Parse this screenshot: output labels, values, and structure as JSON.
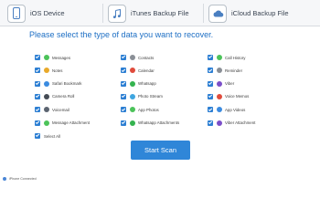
{
  "tabs": [
    {
      "label": "iOS Device",
      "icon": "phone-icon"
    },
    {
      "label": "iTunes Backup File",
      "icon": "music-note-icon"
    },
    {
      "label": "iCloud Backup File",
      "icon": "cloud-icon"
    }
  ],
  "prompt": "Please select the type of data you want to recover.",
  "data_types": {
    "col1": [
      {
        "label": "Messages",
        "color": "#4cc35a"
      },
      {
        "label": "Notes",
        "color": "#e9a92a"
      },
      {
        "label": "Safari Bookmark",
        "color": "#3b8be0"
      },
      {
        "label": "Camera Roll",
        "color": "#454b55"
      },
      {
        "label": "Voicemail",
        "color": "#5b6470"
      },
      {
        "label": "Message Attachment",
        "color": "#4cc35a"
      }
    ],
    "col2": [
      {
        "label": "Contacts",
        "color": "#8a8f96"
      },
      {
        "label": "Calendar",
        "color": "#e04b3c"
      },
      {
        "label": "Whatsapp",
        "color": "#34b34f"
      },
      {
        "label": "Photo Stream",
        "color": "#3fa6e0"
      },
      {
        "label": "App Photos",
        "color": "#4cc35a"
      },
      {
        "label": "Whatsapp Attachments",
        "color": "#34b34f"
      }
    ],
    "col3": [
      {
        "label": "Call History",
        "color": "#4cc35a"
      },
      {
        "label": "Reminder",
        "color": "#8a8f96"
      },
      {
        "label": "Viber",
        "color": "#7b4fc9"
      },
      {
        "label": "Voice Memos",
        "color": "#e04b3c"
      },
      {
        "label": "App Videos",
        "color": "#3b8be0"
      },
      {
        "label": "Viber Attachment",
        "color": "#7b4fc9"
      }
    ]
  },
  "select_all_label": "Select All",
  "start_scan_label": "Start Scan",
  "status_text": "iPhone Connected",
  "accent_color": "#2f86d8",
  "prompt_color": "#1e6fc4"
}
